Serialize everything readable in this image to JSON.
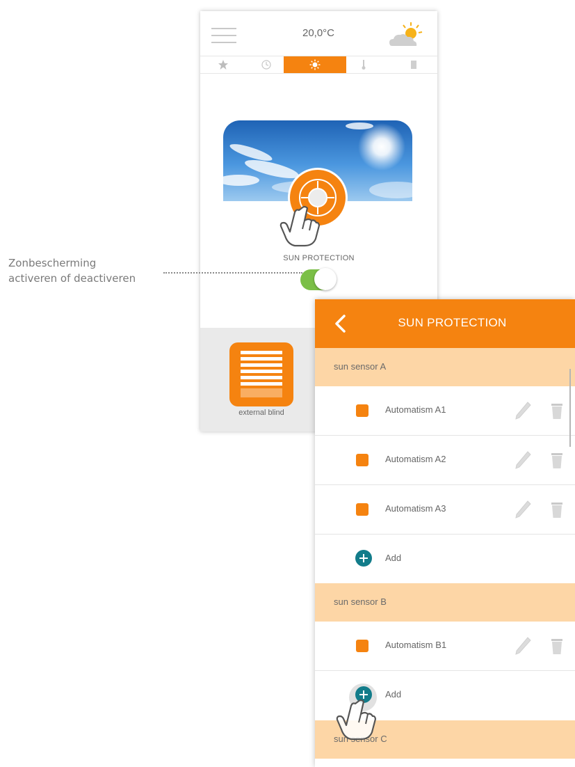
{
  "phone_main": {
    "temperature": "20,0°C",
    "weather_icon": "partly-sunny-icon",
    "tabs": [
      {
        "icon": "star-icon",
        "active": false
      },
      {
        "icon": "clock-icon",
        "active": false
      },
      {
        "icon": "sun-icon",
        "active": true
      },
      {
        "icon": "thermometer-icon",
        "active": false
      },
      {
        "icon": "door-icon",
        "active": false
      }
    ],
    "sun_protection_label": "SUN PROTECTION",
    "toggle_on": true,
    "device_label": "external blind"
  },
  "callout": {
    "line1": "Zonbescherming",
    "line2": "activeren of deactiveren"
  },
  "phone_detail": {
    "title": "SUN PROTECTION",
    "sections": [
      {
        "name": "sun sensor A",
        "items": [
          "Automatism A1",
          "Automatism A2",
          "Automatism A3"
        ],
        "add_label": "Add"
      },
      {
        "name": "sun sensor B",
        "items": [
          "Automatism B1"
        ],
        "add_label": "Add"
      },
      {
        "name": "sun sensor C"
      }
    ]
  },
  "colors": {
    "accent": "#f58310",
    "section_bg": "#fdd6a6",
    "add_button": "#127c8a",
    "toggle_on": "#7bbf47"
  }
}
